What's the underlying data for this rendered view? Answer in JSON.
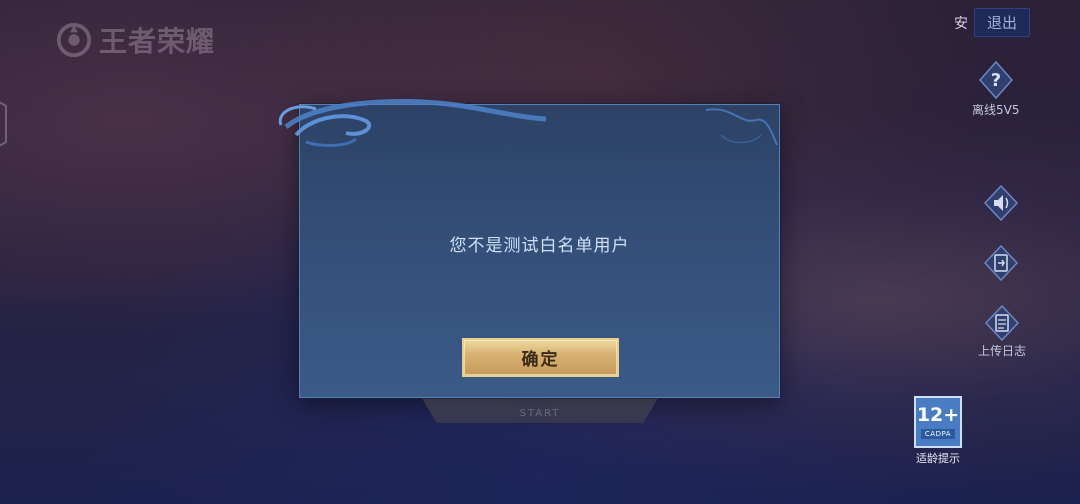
{
  "app": {
    "logo_text": "王者荣耀"
  },
  "top_right": {
    "safe_label": "安",
    "exit_label": "退出"
  },
  "side_menu": {
    "help_label": "离线5V5",
    "upload_label": "上传日志"
  },
  "age_rating": {
    "number": "12+",
    "org": "CADPA",
    "caption": "适龄提示"
  },
  "background": {
    "start_label": "START"
  },
  "dialog": {
    "message": "您不是测试白名单用户",
    "confirm_label": "确定"
  },
  "colors": {
    "dialog_bg": "#35517b",
    "dialog_border": "#5a7fb3",
    "confirm_gold": "#d8b374",
    "message_text": "#cfe0f7"
  }
}
